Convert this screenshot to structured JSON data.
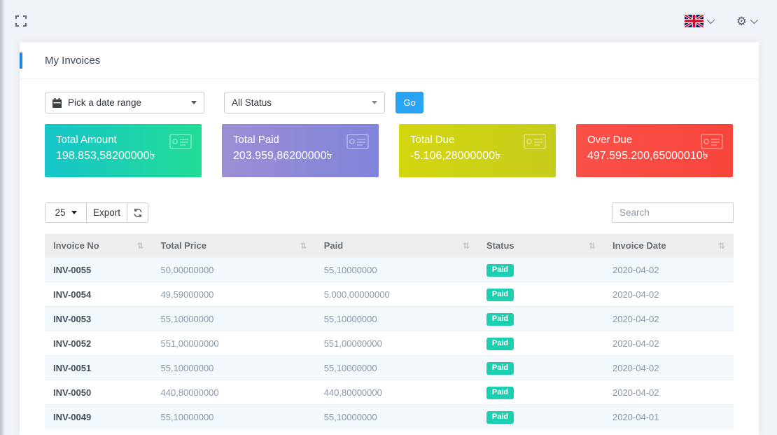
{
  "topbar": {
    "icons": {
      "fullscreen": "fullscreen-toggle",
      "flag": "uk-flag",
      "gear": "⚙",
      "chevron_down": "chevron-down"
    }
  },
  "page": {
    "title": "My Invoices"
  },
  "filters": {
    "date_range": {
      "placeholder": "Pick a date range",
      "icon": "calendar"
    },
    "status": {
      "selected": "All Status"
    },
    "go_label": "Go"
  },
  "stats": [
    {
      "label": "Total Amount",
      "value": "198.853,58200000৳",
      "bg_from": "#16c5c9",
      "bg_to": "#23dc96",
      "icon": "money-check"
    },
    {
      "label": "Total Paid",
      "value": "203.959,86200000৳",
      "bg_from": "#9c8ed5",
      "bg_to": "#8084da",
      "icon": "money-check"
    },
    {
      "label": "Total Due",
      "value": "-5.106,28000000৳",
      "bg_from": "#d2d60f",
      "bg_to": "#c7cc1b",
      "icon": "money-check"
    },
    {
      "label": "Over Due",
      "value": "497.595.200,65000010৳",
      "bg_from": "#fa5048",
      "bg_to": "#f9453c",
      "icon": "money-check"
    }
  ],
  "table_controls": {
    "page_size": "25",
    "export_label": "Export",
    "refresh_icon": "refresh",
    "search_placeholder": "Search"
  },
  "table": {
    "sort_glyph": "⇅",
    "columns": [
      "Invoice No",
      "Total Price",
      "Paid",
      "Status",
      "Invoice Date"
    ],
    "status_badge_color": "#1ccfb0",
    "rows": [
      {
        "invoice_no": "INV-0055",
        "total_price": "50,00000000",
        "paid": "55,10000000",
        "status": "Paid",
        "invoice_date": "2020-04-02"
      },
      {
        "invoice_no": "INV-0054",
        "total_price": "49,59000000",
        "paid": "5.000,00000000",
        "status": "Paid",
        "invoice_date": "2020-04-02"
      },
      {
        "invoice_no": "INV-0053",
        "total_price": "55,10000000",
        "paid": "55,10000000",
        "status": "Paid",
        "invoice_date": "2020-04-02"
      },
      {
        "invoice_no": "INV-0052",
        "total_price": "551,00000000",
        "paid": "551,00000000",
        "status": "Paid",
        "invoice_date": "2020-04-02"
      },
      {
        "invoice_no": "INV-0051",
        "total_price": "55,10000000",
        "paid": "55,10000000",
        "status": "Paid",
        "invoice_date": "2020-04-02"
      },
      {
        "invoice_no": "INV-0050",
        "total_price": "440,80000000",
        "paid": "440,80000000",
        "status": "Paid",
        "invoice_date": "2020-04-02"
      },
      {
        "invoice_no": "INV-0049",
        "total_price": "55,10000000",
        "paid": "55,10000000",
        "status": "Paid",
        "invoice_date": "2020-04-01"
      }
    ]
  },
  "colors": {
    "accent_blue": "#1b84e7",
    "go_button": "#29a3f3",
    "table_header_bg": "#ededed",
    "row_alt_bg": "#f3f8fc"
  }
}
